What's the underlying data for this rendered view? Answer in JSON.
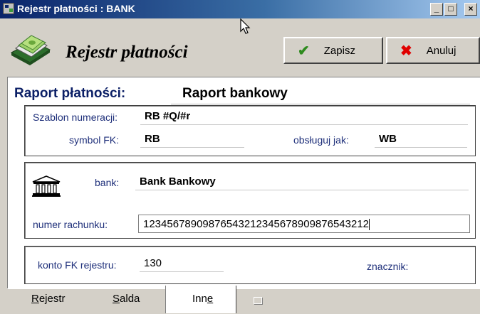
{
  "window": {
    "title": "Rejestr płatności : BANK",
    "minimize_glyph": "_",
    "maximize_glyph": "□",
    "close_glyph": "×"
  },
  "header": {
    "title": "Rejestr płatności",
    "icon": "money-book-icon"
  },
  "toolbar": {
    "save_label": "Zapisz",
    "save_icon": "checkmark-icon",
    "cancel_label": "Anuluj",
    "cancel_icon": "x-icon"
  },
  "report": {
    "label": "Raport płatności:",
    "value": "Raport bankowy"
  },
  "numbering": {
    "template_label": "Szablon numeracji:",
    "template_value": "RB #Q/#r",
    "symbol_label": "symbol FK:",
    "symbol_value": "RB",
    "handle_label": "obsługuj jak:",
    "handle_value": "WB"
  },
  "bank": {
    "icon": "bank-building-icon",
    "bank_label": "bank:",
    "bank_value": "Bank Bankowy",
    "account_label": "numer rachunku:",
    "account_value": "12345678909876543212345678909876543212"
  },
  "ledger": {
    "account_label": "konto FK rejestru:",
    "account_value": "130",
    "marker_label": "znacznik:",
    "marker_value": ""
  },
  "tabs": [
    {
      "label": "Rejestr",
      "shortcut": "R"
    },
    {
      "label": "Salda",
      "shortcut": "S"
    },
    {
      "label": "Inne",
      "shortcut": "e",
      "active": true
    }
  ],
  "colors": {
    "accent": "#0b1f66",
    "title_bar": "#0a246a",
    "save_icon": "#2e8b1e",
    "cancel_icon": "#e00000"
  }
}
